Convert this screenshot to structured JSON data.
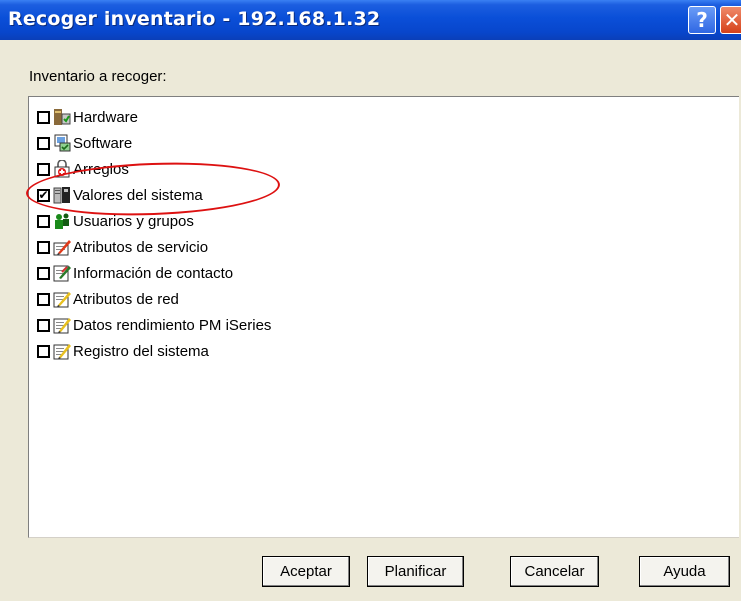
{
  "window": {
    "title": "Recoger inventario - 192.168.1.32",
    "help_button": "?",
    "close_button": "✕"
  },
  "section_label": "Inventario a recoger:",
  "items": [
    {
      "label": "Hardware",
      "checked": false,
      "icon": "hardware-icon"
    },
    {
      "label": "Software",
      "checked": false,
      "icon": "software-icon"
    },
    {
      "label": "Arreglos",
      "checked": false,
      "icon": "fixes-icon"
    },
    {
      "label": "Valores del sistema",
      "checked": true,
      "icon": "system-values-icon"
    },
    {
      "label": "Usuarios y grupos",
      "checked": false,
      "icon": "users-groups-icon"
    },
    {
      "label": "Atributos de servicio",
      "checked": false,
      "icon": "service-attributes-icon"
    },
    {
      "label": "Información de contacto",
      "checked": false,
      "icon": "contact-info-icon"
    },
    {
      "label": "Atributos de red",
      "checked": false,
      "icon": "network-attributes-icon"
    },
    {
      "label": "Datos rendimiento PM iSeries",
      "checked": false,
      "icon": "pm-data-icon"
    },
    {
      "label": "Registro del sistema",
      "checked": false,
      "icon": "system-log-icon"
    }
  ],
  "buttons": {
    "accept": "Aceptar",
    "schedule": "Planificar",
    "cancel": "Cancelar",
    "help": "Ayuda"
  },
  "colors": {
    "titlebar": "#0a4fd8",
    "dialog_bg": "#ece9d8",
    "annotation": "#dd1111"
  }
}
